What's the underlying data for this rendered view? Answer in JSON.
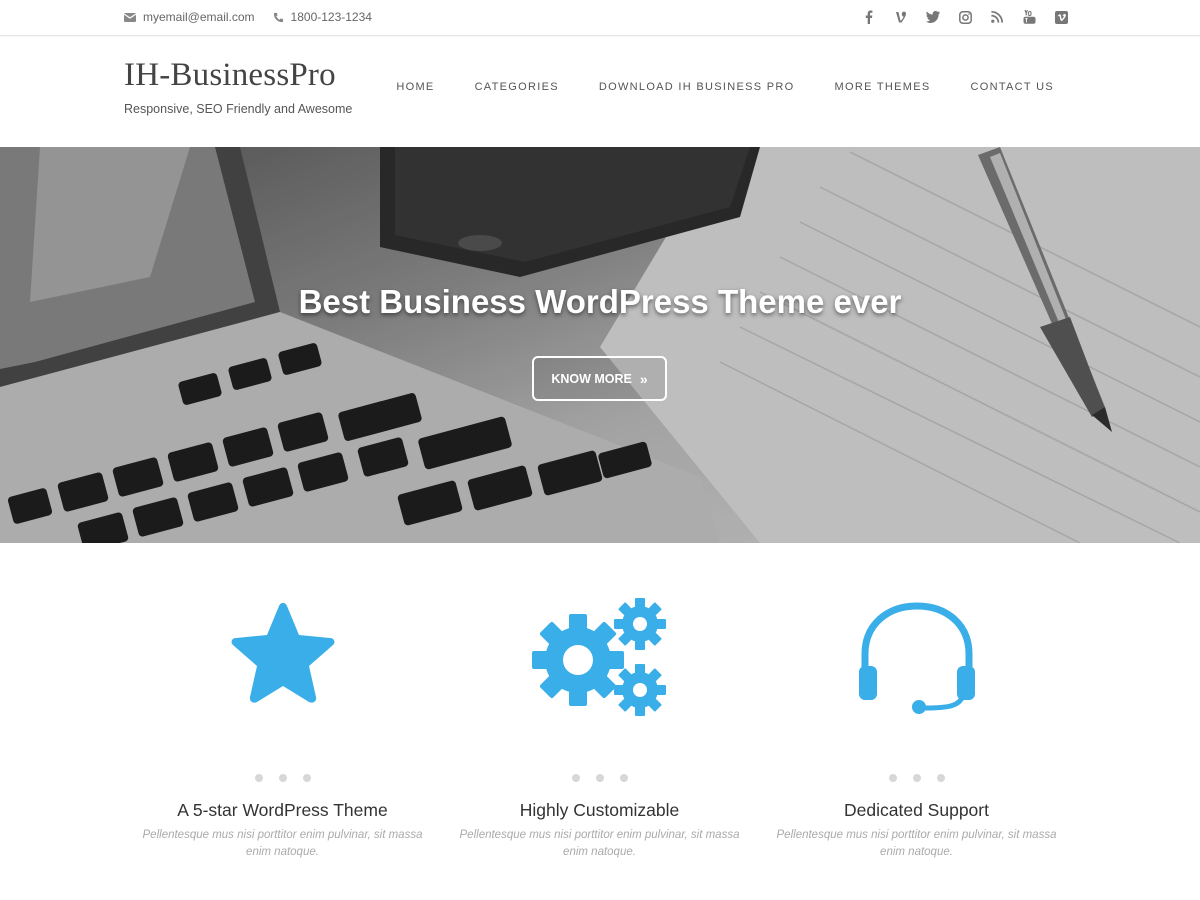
{
  "topbar": {
    "email": "myemail@email.com",
    "phone": "1800-123-1234",
    "social_icons": [
      "facebook-icon",
      "vine-icon",
      "twitter-icon",
      "instagram-icon",
      "rss-icon",
      "youtube-icon",
      "vimeo-icon"
    ]
  },
  "header": {
    "site_title": "IH-BusinessPro",
    "tagline": "Responsive, SEO Friendly and Awesome"
  },
  "nav": {
    "items": [
      "HOME",
      "CATEGORIES",
      "DOWNLOAD IH BUSINESS PRO",
      "MORE THEMES",
      "CONTACT US"
    ]
  },
  "hero": {
    "heading": "Best Business WordPress Theme ever",
    "button_label": "KNOW MORE"
  },
  "features": [
    {
      "icon": "star-icon",
      "title": "A 5-star WordPress Theme",
      "description": "Pellentesque mus nisi porttitor enim pulvinar, sit massa enim natoque."
    },
    {
      "icon": "gears-icon",
      "title": "Highly Customizable",
      "description": "Pellentesque mus nisi porttitor enim pulvinar, sit massa enim natoque."
    },
    {
      "icon": "headset-icon",
      "title": "Dedicated Support",
      "description": "Pellentesque mus nisi porttitor enim pulvinar, sit massa enim natoque."
    }
  ],
  "colors": {
    "accent": "#3aaee8",
    "text": "#444444",
    "muted": "#aaaaaa"
  }
}
